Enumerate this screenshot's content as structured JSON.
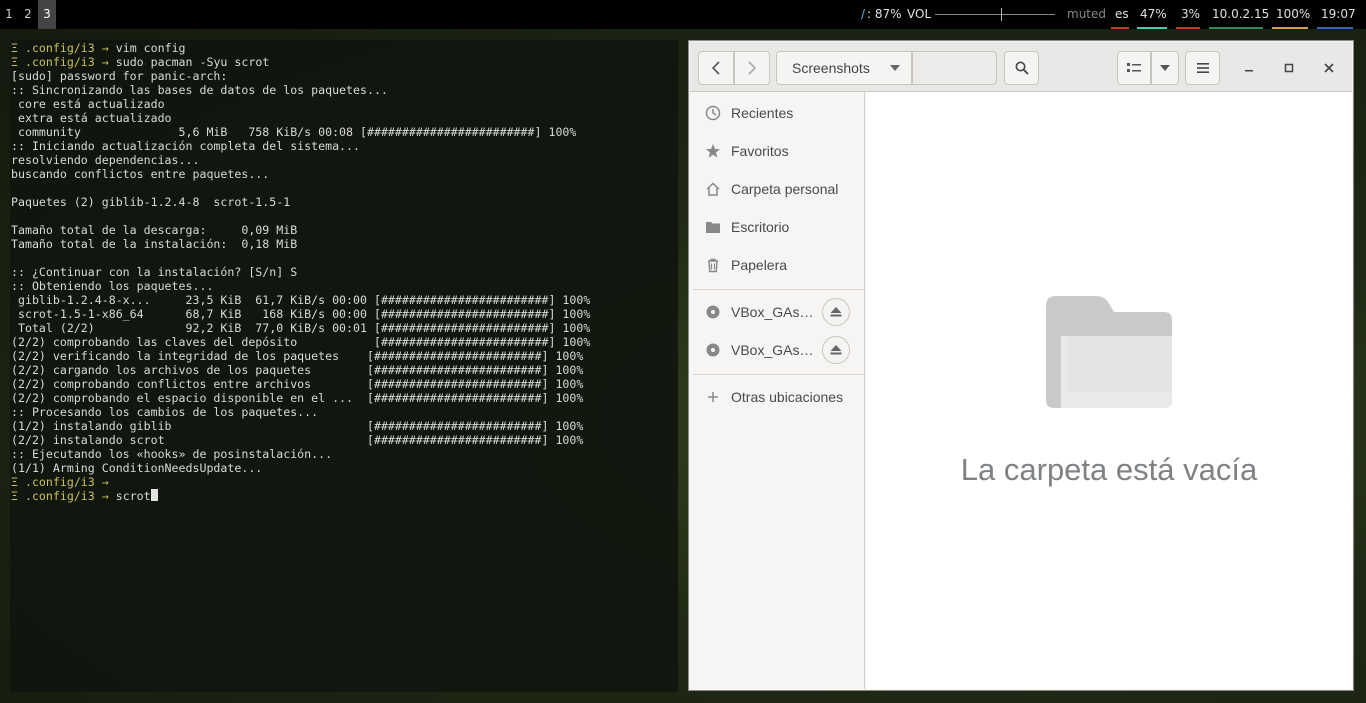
{
  "topbar": {
    "workspaces": [
      "1",
      "2",
      "3"
    ],
    "active_workspace": "3",
    "disk": ": 87%",
    "disk_icon": "/",
    "volume_label": "VOL",
    "volume_level": 0.55,
    "muted": "muted",
    "keyboard": "es",
    "brightness": "47%",
    "cpu": "3%",
    "ip": "10.0.2.15",
    "battery": "100%",
    "clock": "19:07",
    "colors": {
      "disk_icon": "#5fafd7",
      "ul_kbd": "#c0392b",
      "ul_bright": "#48c9b0",
      "ul_cpu": "#c0392b",
      "ul_ip": "#2e8b57",
      "ul_bat": "#d4a04a",
      "ul_clock": "#3b5fc0"
    }
  },
  "terminal": {
    "prompt_symbol": "Ξ",
    "prompt_dir": ".config/i3",
    "prompt_arrow": "→",
    "lines": [
      {
        "type": "prompt",
        "cmd": "vim config"
      },
      {
        "type": "prompt",
        "cmd": "sudo pacman -Syu scrot"
      },
      {
        "type": "out",
        "text": "[sudo] password for panic-arch:"
      },
      {
        "type": "out",
        "text": ":: Sincronizando las bases de datos de los paquetes..."
      },
      {
        "type": "out",
        "text": " core está actualizado"
      },
      {
        "type": "out",
        "text": " extra está actualizado"
      },
      {
        "type": "out",
        "text": " community              5,6 MiB   758 KiB/s 00:08 [########################] 100%"
      },
      {
        "type": "out",
        "text": ":: Iniciando actualización completa del sistema..."
      },
      {
        "type": "out",
        "text": "resolviendo dependencias..."
      },
      {
        "type": "out",
        "text": "buscando conflictos entre paquetes..."
      },
      {
        "type": "out",
        "text": ""
      },
      {
        "type": "out",
        "text": "Paquetes (2) giblib-1.2.4-8  scrot-1.5-1"
      },
      {
        "type": "out",
        "text": ""
      },
      {
        "type": "out",
        "text": "Tamaño total de la descarga:     0,09 MiB"
      },
      {
        "type": "out",
        "text": "Tamaño total de la instalación:  0,18 MiB"
      },
      {
        "type": "out",
        "text": ""
      },
      {
        "type": "out",
        "text": ":: ¿Continuar con la instalación? [S/n] S"
      },
      {
        "type": "out",
        "text": ":: Obteniendo los paquetes..."
      },
      {
        "type": "out",
        "text": " giblib-1.2.4-8-x...     23,5 KiB  61,7 KiB/s 00:00 [########################] 100%"
      },
      {
        "type": "out",
        "text": " scrot-1.5-1-x86_64      68,7 KiB   168 KiB/s 00:00 [########################] 100%"
      },
      {
        "type": "out",
        "text": " Total (2/2)             92,2 KiB  77,0 KiB/s 00:01 [########################] 100%"
      },
      {
        "type": "out",
        "text": "(2/2) comprobando las claves del depósito           [########################] 100%"
      },
      {
        "type": "out",
        "text": "(2/2) verificando la integridad de los paquetes    [########################] 100%"
      },
      {
        "type": "out",
        "text": "(2/2) cargando los archivos de los paquetes        [########################] 100%"
      },
      {
        "type": "out",
        "text": "(2/2) comprobando conflictos entre archivos        [########################] 100%"
      },
      {
        "type": "out",
        "text": "(2/2) comprobando el espacio disponible en el ...  [########################] 100%"
      },
      {
        "type": "out",
        "text": ":: Procesando los cambios de los paquetes..."
      },
      {
        "type": "out",
        "text": "(1/2) instalando giblib                            [########################] 100%"
      },
      {
        "type": "out",
        "text": "(2/2) instalando scrot                             [########################] 100%"
      },
      {
        "type": "out",
        "text": ":: Ejecutando los «hooks» de posinstalación..."
      },
      {
        "type": "out",
        "text": "(1/1) Arming ConditionNeedsUpdate..."
      },
      {
        "type": "prompt",
        "cmd": ""
      },
      {
        "type": "prompt",
        "cmd": "scrot",
        "cursor": true
      }
    ]
  },
  "files": {
    "path_label": "Screenshots",
    "search_placeholder": "",
    "sidebar": {
      "recent": "Recientes",
      "starred": "Favoritos",
      "home": "Carpeta personal",
      "desktop": "Escritorio",
      "trash": "Papelera",
      "vbox1": "VBox_GAs…",
      "vbox2": "VBox_GAs…",
      "other": "Otras ubicaciones"
    },
    "empty_message": "La carpeta está vacía"
  }
}
